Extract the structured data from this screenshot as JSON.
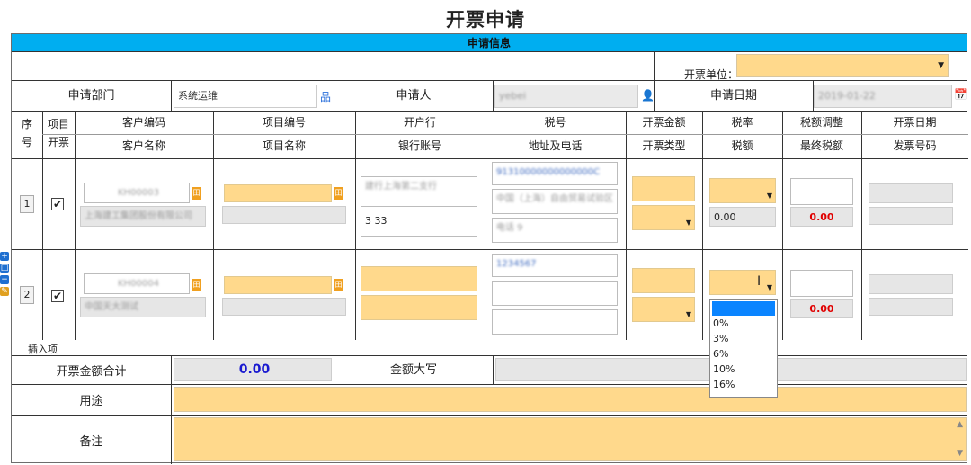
{
  "page": {
    "title": "开票申请"
  },
  "section": {
    "header": "申请信息"
  },
  "unit": {
    "label": "开票单位：",
    "value": ""
  },
  "applicant": {
    "dept_label": "申请部门",
    "dept_value": "系统运维",
    "person_label": "申请人",
    "person_value": "yebei",
    "date_label": "申请日期",
    "date_value": "2019-01-22"
  },
  "grid": {
    "headers_top": [
      "序",
      "项目",
      "客户编码",
      "项目编号",
      "开户行",
      "税号",
      "开票金额",
      "税率",
      "税额调整",
      "开票日期"
    ],
    "headers_bottom": [
      "号",
      "开票",
      "客户名称",
      "项目名称",
      "银行账号",
      "地址及电话",
      "开票类型",
      "税额",
      "最终税额",
      "发票号码"
    ],
    "rows": [
      {
        "no": "1",
        "checked": "✔",
        "customer_code": "KH00003",
        "customer_name": "上海建工集团股份有限公司",
        "bank": "建行上海第二支行",
        "account": "3                              33",
        "tax_no": "91310000000000000C",
        "address": "中国（上海）自由贸易试验区",
        "phone": "电话                    9",
        "tax_amount": "0.00",
        "final_tax": "0.00"
      },
      {
        "no": "2",
        "checked": "✔",
        "customer_code": "KH00004",
        "customer_name": "中国天大测试",
        "tax_no": "1234567",
        "final_tax": "0.00"
      }
    ]
  },
  "tax_rate_dropdown": {
    "options": [
      "",
      "0%",
      "3%",
      "6%",
      "10%",
      "16%"
    ]
  },
  "side_icons": [
    "plus-icon",
    "minus-icon",
    "copy-icon",
    "delete-icon"
  ],
  "insert_label": "插入项",
  "totals": {
    "amount_label": "开票金额合计",
    "amount_value": "0.00",
    "uppercase_label": "金额大写"
  },
  "usage": {
    "label": "用途"
  },
  "remark": {
    "label": "备注"
  },
  "colors": {
    "header_bar": "#00aef0",
    "required_field": "#ffd98c",
    "readonly_field": "#e6e6e6",
    "total_value": "#1a1ad0",
    "tax_red": "#e00000"
  }
}
